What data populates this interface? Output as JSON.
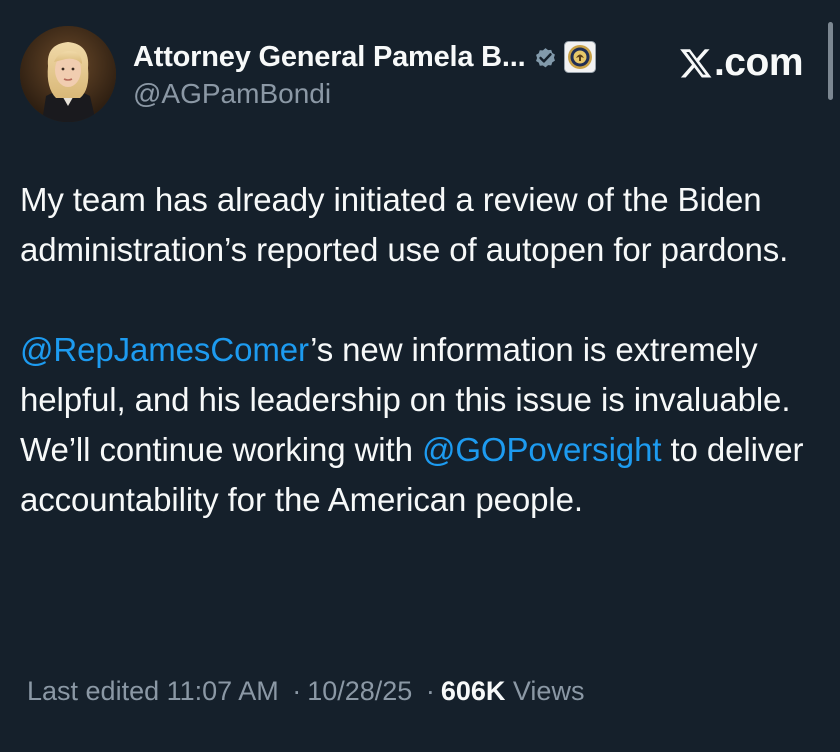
{
  "author": {
    "display_name": "Attorney General Pamela B...",
    "handle": "@AGPamBondi",
    "avatar_icon": "profile-photo",
    "verified_icon": "verified-badge-icon",
    "affiliate_icon": "doj-seal-icon"
  },
  "brand": {
    "logo_icon": "x-logo-icon",
    "domain": ".com"
  },
  "tweet": {
    "paragraph1": "My team has already initiated a review of the Biden administration’s reported use of autopen for pardons.",
    "paragraph2": {
      "mention1": "@RepJamesComer",
      "text1": "’s new information is extremely helpful, and his leadership on this issue is invaluable. We’ll continue working with ",
      "mention2": "@GOPoversight",
      "text2": " to deliver accountability for the American people."
    }
  },
  "meta": {
    "edited_label": "Last edited",
    "time": "11:07 AM",
    "separator": "·",
    "date": "10/28/25",
    "views_count": "606K",
    "views_label": "Views"
  },
  "colors": {
    "background": "#15202b",
    "text": "#f7f9f9",
    "secondary": "#8b98a5",
    "mention": "#1d9bf0"
  }
}
